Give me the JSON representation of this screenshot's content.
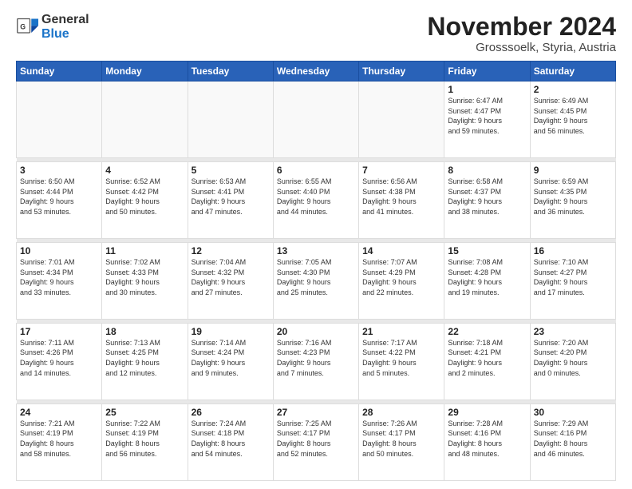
{
  "logo": {
    "general": "General",
    "blue": "Blue"
  },
  "title": "November 2024",
  "subtitle": "Grosssoelk, Styria, Austria",
  "headers": [
    "Sunday",
    "Monday",
    "Tuesday",
    "Wednesday",
    "Thursday",
    "Friday",
    "Saturday"
  ],
  "weeks": [
    [
      {
        "day": "",
        "info": ""
      },
      {
        "day": "",
        "info": ""
      },
      {
        "day": "",
        "info": ""
      },
      {
        "day": "",
        "info": ""
      },
      {
        "day": "",
        "info": ""
      },
      {
        "day": "1",
        "info": "Sunrise: 6:47 AM\nSunset: 4:47 PM\nDaylight: 9 hours\nand 59 minutes."
      },
      {
        "day": "2",
        "info": "Sunrise: 6:49 AM\nSunset: 4:45 PM\nDaylight: 9 hours\nand 56 minutes."
      }
    ],
    [
      {
        "day": "3",
        "info": "Sunrise: 6:50 AM\nSunset: 4:44 PM\nDaylight: 9 hours\nand 53 minutes."
      },
      {
        "day": "4",
        "info": "Sunrise: 6:52 AM\nSunset: 4:42 PM\nDaylight: 9 hours\nand 50 minutes."
      },
      {
        "day": "5",
        "info": "Sunrise: 6:53 AM\nSunset: 4:41 PM\nDaylight: 9 hours\nand 47 minutes."
      },
      {
        "day": "6",
        "info": "Sunrise: 6:55 AM\nSunset: 4:40 PM\nDaylight: 9 hours\nand 44 minutes."
      },
      {
        "day": "7",
        "info": "Sunrise: 6:56 AM\nSunset: 4:38 PM\nDaylight: 9 hours\nand 41 minutes."
      },
      {
        "day": "8",
        "info": "Sunrise: 6:58 AM\nSunset: 4:37 PM\nDaylight: 9 hours\nand 38 minutes."
      },
      {
        "day": "9",
        "info": "Sunrise: 6:59 AM\nSunset: 4:35 PM\nDaylight: 9 hours\nand 36 minutes."
      }
    ],
    [
      {
        "day": "10",
        "info": "Sunrise: 7:01 AM\nSunset: 4:34 PM\nDaylight: 9 hours\nand 33 minutes."
      },
      {
        "day": "11",
        "info": "Sunrise: 7:02 AM\nSunset: 4:33 PM\nDaylight: 9 hours\nand 30 minutes."
      },
      {
        "day": "12",
        "info": "Sunrise: 7:04 AM\nSunset: 4:32 PM\nDaylight: 9 hours\nand 27 minutes."
      },
      {
        "day": "13",
        "info": "Sunrise: 7:05 AM\nSunset: 4:30 PM\nDaylight: 9 hours\nand 25 minutes."
      },
      {
        "day": "14",
        "info": "Sunrise: 7:07 AM\nSunset: 4:29 PM\nDaylight: 9 hours\nand 22 minutes."
      },
      {
        "day": "15",
        "info": "Sunrise: 7:08 AM\nSunset: 4:28 PM\nDaylight: 9 hours\nand 19 minutes."
      },
      {
        "day": "16",
        "info": "Sunrise: 7:10 AM\nSunset: 4:27 PM\nDaylight: 9 hours\nand 17 minutes."
      }
    ],
    [
      {
        "day": "17",
        "info": "Sunrise: 7:11 AM\nSunset: 4:26 PM\nDaylight: 9 hours\nand 14 minutes."
      },
      {
        "day": "18",
        "info": "Sunrise: 7:13 AM\nSunset: 4:25 PM\nDaylight: 9 hours\nand 12 minutes."
      },
      {
        "day": "19",
        "info": "Sunrise: 7:14 AM\nSunset: 4:24 PM\nDaylight: 9 hours\nand 9 minutes."
      },
      {
        "day": "20",
        "info": "Sunrise: 7:16 AM\nSunset: 4:23 PM\nDaylight: 9 hours\nand 7 minutes."
      },
      {
        "day": "21",
        "info": "Sunrise: 7:17 AM\nSunset: 4:22 PM\nDaylight: 9 hours\nand 5 minutes."
      },
      {
        "day": "22",
        "info": "Sunrise: 7:18 AM\nSunset: 4:21 PM\nDaylight: 9 hours\nand 2 minutes."
      },
      {
        "day": "23",
        "info": "Sunrise: 7:20 AM\nSunset: 4:20 PM\nDaylight: 9 hours\nand 0 minutes."
      }
    ],
    [
      {
        "day": "24",
        "info": "Sunrise: 7:21 AM\nSunset: 4:19 PM\nDaylight: 8 hours\nand 58 minutes."
      },
      {
        "day": "25",
        "info": "Sunrise: 7:22 AM\nSunset: 4:19 PM\nDaylight: 8 hours\nand 56 minutes."
      },
      {
        "day": "26",
        "info": "Sunrise: 7:24 AM\nSunset: 4:18 PM\nDaylight: 8 hours\nand 54 minutes."
      },
      {
        "day": "27",
        "info": "Sunrise: 7:25 AM\nSunset: 4:17 PM\nDaylight: 8 hours\nand 52 minutes."
      },
      {
        "day": "28",
        "info": "Sunrise: 7:26 AM\nSunset: 4:17 PM\nDaylight: 8 hours\nand 50 minutes."
      },
      {
        "day": "29",
        "info": "Sunrise: 7:28 AM\nSunset: 4:16 PM\nDaylight: 8 hours\nand 48 minutes."
      },
      {
        "day": "30",
        "info": "Sunrise: 7:29 AM\nSunset: 4:16 PM\nDaylight: 8 hours\nand 46 minutes."
      }
    ]
  ]
}
